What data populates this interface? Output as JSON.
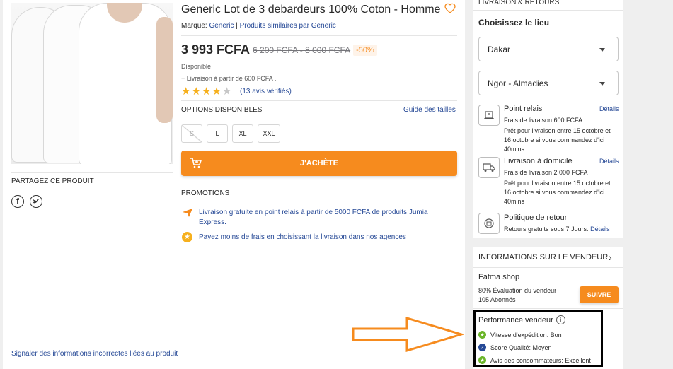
{
  "product": {
    "title": "Generic Lot de 3 debardeurs 100% Coton - Homme",
    "brand_prefix": "Marque: ",
    "brand": "Generic",
    "similar_sep": " | ",
    "similar": "Produits similaires par Generic",
    "price": "3 993 FCFA",
    "old_price": "6 200 FCFA - 8 000 FCFA",
    "discount": "-50%",
    "availability": "Disponible",
    "delivery_note": "+ Livraison à partir de 600 FCFA .",
    "rating_stars": 4,
    "rating_max": 5,
    "reviews": "(13 avis vérifiés)"
  },
  "options": {
    "heading": "OPTIONS DISPONIBLES",
    "size_guide": "Guide des tailles",
    "sizes": [
      "S",
      "L",
      "XL",
      "XXL"
    ]
  },
  "cta": {
    "buy": "J'ACHÈTE"
  },
  "share": {
    "heading": "PARTAGEZ CE PRODUIT"
  },
  "promotions": {
    "heading": "PROMOTIONS",
    "items": [
      "Livraison gratuite en point relais à partir de 5000 FCFA de produits Jumia Express.",
      "Payez moins de frais en choisissant la livraison dans nos agences"
    ]
  },
  "report_link": "Signaler des informations incorrectes liées au produit",
  "delivery": {
    "heading": "LIVRAISON & RETOURS",
    "choose_place": "Choisissez le lieu",
    "city": "Dakar",
    "area": "Ngor - Almadies",
    "pickup": {
      "title": "Point relais",
      "details": "Détails",
      "fee": "Frais de livraison 600 FCFA",
      "eta": "Prêt pour livraison entre 15 octobre et 16 octobre si vous commandez d'ici 40mins"
    },
    "home": {
      "title": "Livraison à domicile",
      "details": "Détails",
      "fee": "Frais de livraison 2 000 FCFA",
      "eta": "Prêt pour livraison entre 15 octobre et 16 octobre si vous commandez d'ici 40mins"
    },
    "returns": {
      "title": "Politique de retour",
      "text": "Retours gratuits sous 7 Jours.",
      "details": "Détails"
    }
  },
  "seller": {
    "heading": "INFORMATIONS SUR LE VENDEUR",
    "name": "Fatma shop",
    "rating": "80% Évaluation du vendeur",
    "followers": "105 Abonnés",
    "follow": "SUIVRE",
    "performance_heading": "Performance vendeur",
    "metrics": [
      {
        "label": "Vitesse d'expédition: Bon",
        "color": "#6bb52a"
      },
      {
        "label": "Score Qualité: Moyen",
        "color": "#264996"
      },
      {
        "label": "Avis des consommateurs: Excellent",
        "color": "#6bb52a"
      }
    ]
  },
  "colors": {
    "accent": "#f68b1e",
    "link": "#264996",
    "arrow": "#f68b1e"
  }
}
